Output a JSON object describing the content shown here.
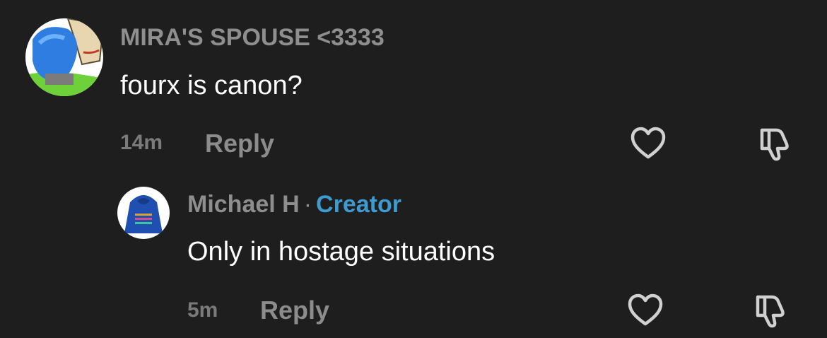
{
  "comments": [
    {
      "author": "MIRA'S SPOUSE <3333",
      "text": "fourx is canon?",
      "time": "14m",
      "reply_label": "Reply",
      "avatar_icon": "avatar-blue-drawing",
      "like_icon": "heart-outline-icon",
      "dislike_icon": "thumbs-down-outline-icon"
    },
    {
      "author": "Michael H",
      "separator": "·",
      "badge": "Creator",
      "text": "Only in hostage situations",
      "time": "5m",
      "reply_label": "Reply",
      "avatar_icon": "avatar-blue-hoodie",
      "like_icon": "heart-outline-icon",
      "dislike_icon": "thumbs-down-outline-icon"
    }
  ],
  "colors": {
    "background": "#1e1e1e",
    "creator_badge": "#3d9bd0",
    "author": "#8e8e8e",
    "text": "#ffffff"
  }
}
